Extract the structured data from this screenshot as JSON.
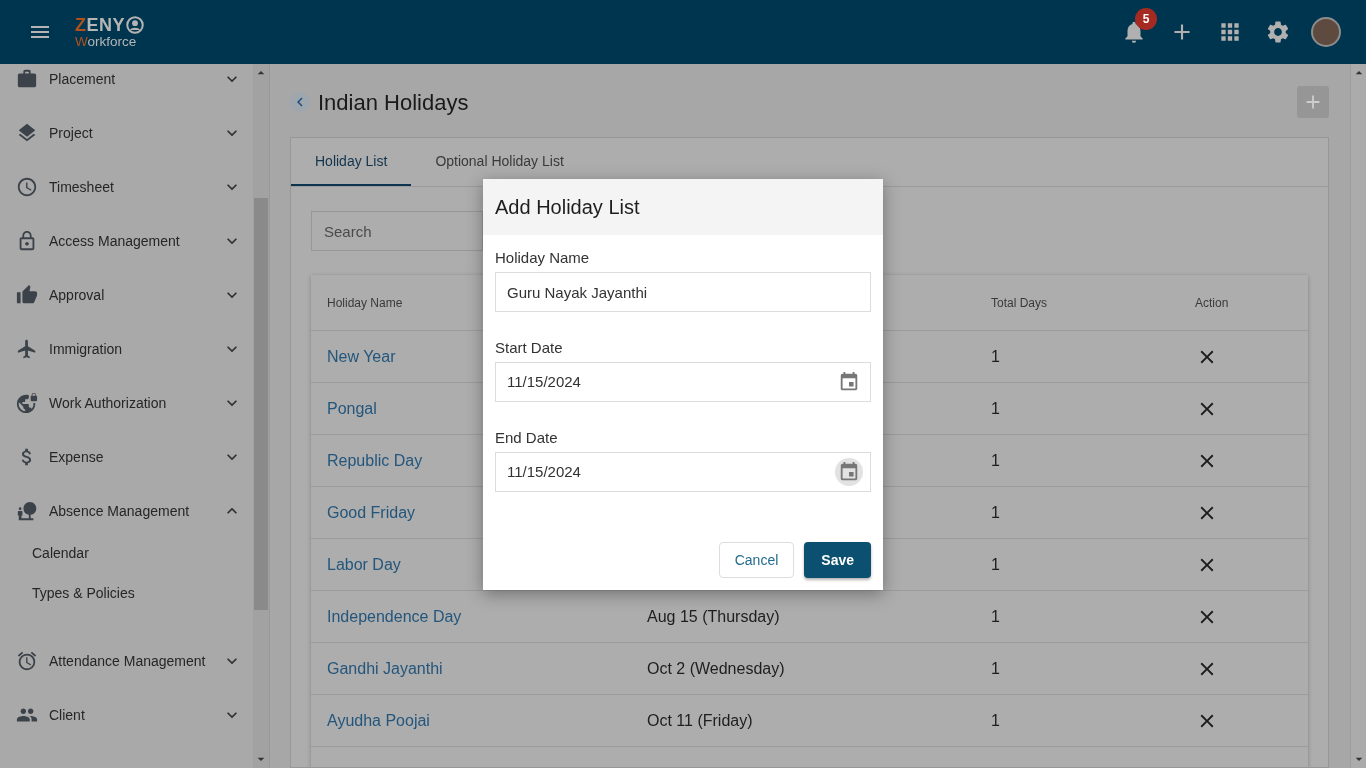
{
  "top_bar": {
    "logo": {
      "title": "ZENY",
      "subtitle": "Workforce"
    },
    "notifications": {
      "count": "5"
    }
  },
  "sidebar": {
    "items": [
      {
        "label": "Placement",
        "expanded": false
      },
      {
        "label": "Project",
        "expanded": false
      },
      {
        "label": "Timesheet",
        "expanded": false
      },
      {
        "label": "Access Management",
        "expanded": false
      },
      {
        "label": "Approval",
        "expanded": false
      },
      {
        "label": "Immigration",
        "expanded": false
      },
      {
        "label": "Work Authorization",
        "expanded": false
      },
      {
        "label": "Expense",
        "expanded": false
      },
      {
        "label": "Absence Management",
        "expanded": true,
        "children": [
          {
            "label": "Calendar"
          },
          {
            "label": "Types & Policies"
          }
        ]
      },
      {
        "label": "Attendance Management",
        "expanded": false
      },
      {
        "label": "Client",
        "expanded": false
      }
    ]
  },
  "page": {
    "title": "Indian Holidays",
    "tabs": [
      {
        "label": "Holiday List",
        "selected": true
      },
      {
        "label": "Optional Holiday List",
        "selected": false
      }
    ],
    "search": {
      "placeholder": "Search"
    },
    "table": {
      "columns": {
        "name": "Holiday Name",
        "total_days": "Total Days",
        "action": "Action"
      },
      "rows": [
        {
          "name": "New Year",
          "total_days": "1"
        },
        {
          "name": "Pongal",
          "total_days": "1"
        },
        {
          "name": "Republic Day",
          "total_days": "1"
        },
        {
          "name": "Good Friday",
          "total_days": "1"
        },
        {
          "name": "Labor Day",
          "total_days": "1"
        },
        {
          "name": "Independence Day",
          "date": "Aug 15 (Thursday)",
          "total_days": "1"
        },
        {
          "name": "Gandhi Jayanthi",
          "date": "Oct 2 (Wednesday)",
          "total_days": "1"
        },
        {
          "name": "Ayudha Poojai",
          "date": "Oct 11 (Friday)",
          "total_days": "1"
        }
      ]
    }
  },
  "dialog": {
    "title": "Add Holiday List",
    "fields": [
      {
        "kind": "text",
        "label": "Holiday Name",
        "value": "Guru Nayak Jayanthi"
      },
      {
        "kind": "date",
        "label": "Start Date",
        "value": "11/15/2024",
        "picker_hovered": false
      },
      {
        "kind": "date",
        "label": "End Date",
        "value": "11/15/2024",
        "picker_hovered": true
      }
    ],
    "buttons": [
      {
        "kind": "secondary",
        "label": "Cancel"
      },
      {
        "kind": "primary",
        "label": "Save"
      }
    ]
  }
}
